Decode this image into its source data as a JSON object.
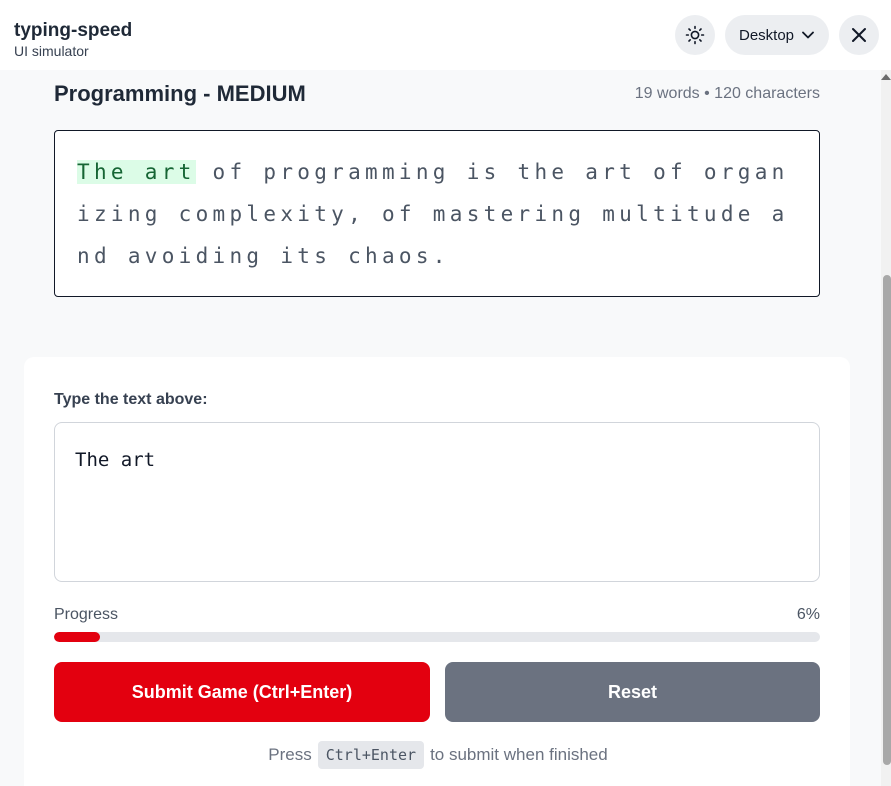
{
  "app": {
    "title": "typing-speed",
    "subtitle": "UI simulator",
    "device_label": "Desktop"
  },
  "icons": {
    "theme": "sun-icon",
    "device_chevron": "chevron-down-icon",
    "close": "close-icon"
  },
  "passage": {
    "title": "Programming - MEDIUM",
    "meta": "19 words • 120 characters",
    "typed_text": "The art",
    "remaining_text": " of programming is the art of organizing complexity, of mastering multitude and avoiding its chaos."
  },
  "input": {
    "label": "Type the text above:",
    "value": "The art"
  },
  "progress": {
    "label": "Progress",
    "percent_text": "6%",
    "fraction": 0.06,
    "color": "#e3000f"
  },
  "buttons": {
    "submit_label": "Submit Game (Ctrl+Enter)",
    "reset_label": "Reset"
  },
  "hint": {
    "prefix": "Press",
    "shortcut": "Ctrl+Enter",
    "suffix": "to submit when finished"
  },
  "colors": {
    "accent": "#e3000f",
    "typed_highlight": "#dcfce7",
    "reset_button": "#6b7280"
  }
}
